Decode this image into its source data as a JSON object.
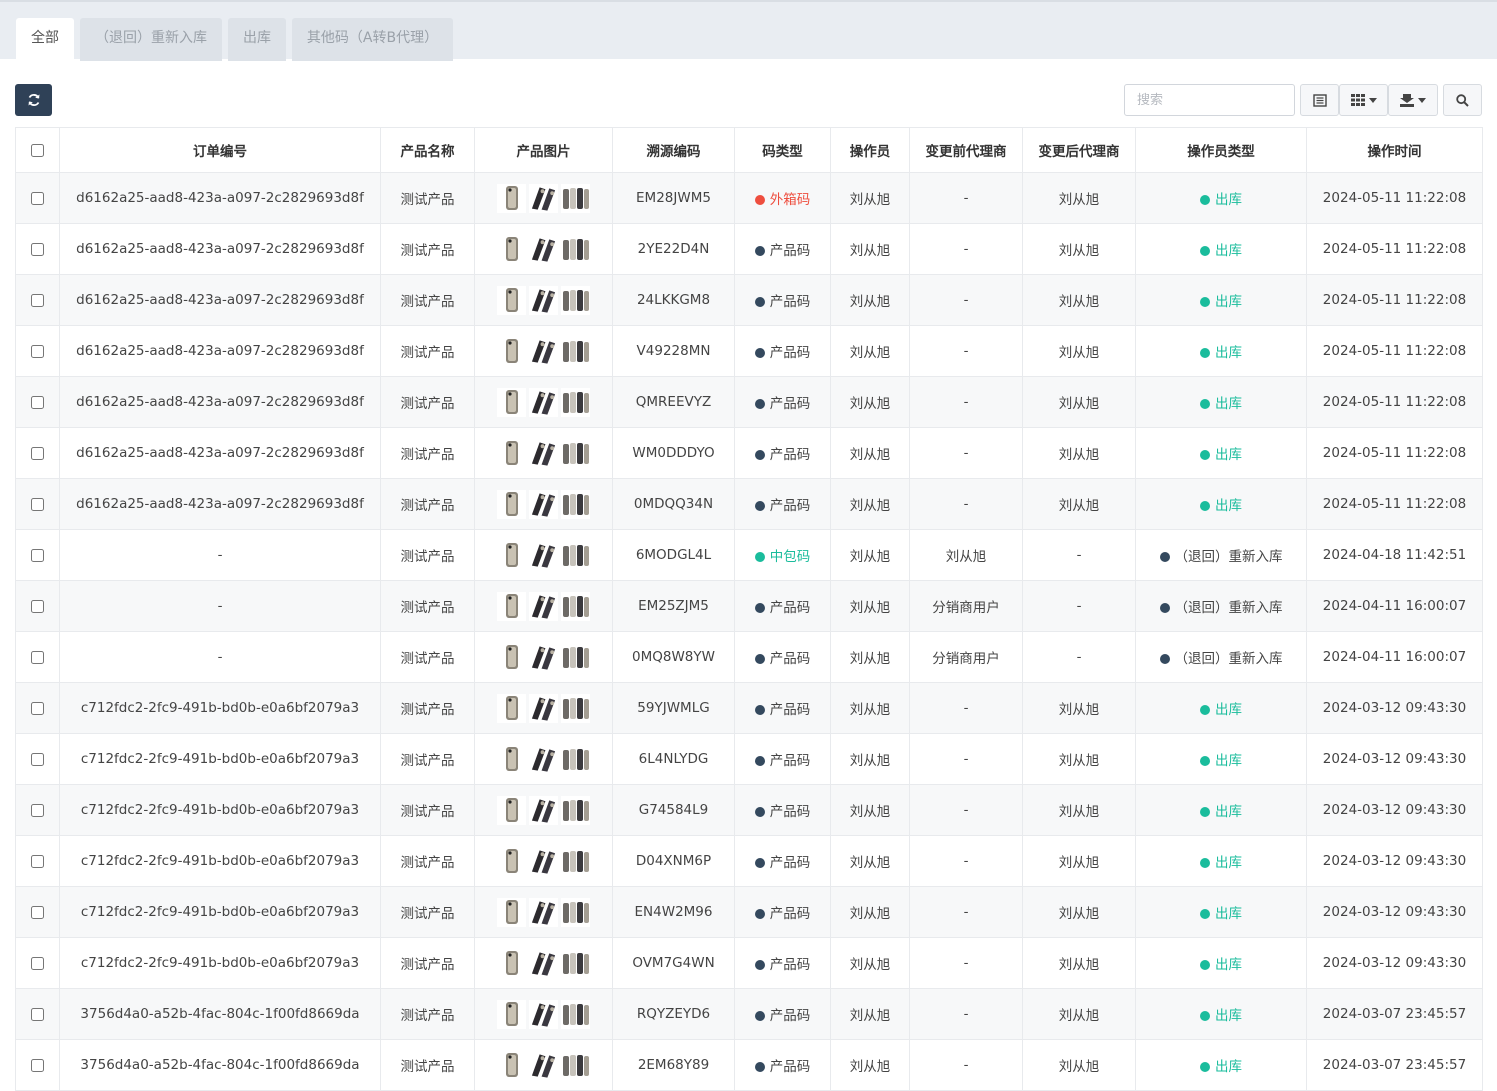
{
  "tabs": [
    {
      "label": "全部"
    },
    {
      "label": "（退回）重新入库"
    },
    {
      "label": "出库"
    },
    {
      "label": "其他码（A转B代理）"
    }
  ],
  "search": {
    "placeholder": "搜索"
  },
  "colors": {
    "red": "#ee4e3f",
    "green": "#1abc9c",
    "navy": "#34495e",
    "refresh": "#2f4157"
  },
  "table": {
    "headers": [
      "订单编号",
      "产品名称",
      "产品图片",
      "溯源编码",
      "码类型",
      "操作员",
      "变更前代理商",
      "变更后代理商",
      "操作员类型",
      "操作时间"
    ],
    "rows": [
      {
        "order": "d6162a25-aad8-423a-a097-2c2829693d8f",
        "product": "测试产品",
        "code": "EM28JWM5",
        "type": "外箱码",
        "type_color": "#ee4e3f",
        "operator": "刘从旭",
        "before": "-",
        "after": "刘从旭",
        "op_type": "出库",
        "op_color": "#1abc9c",
        "time": "2024-05-11 11:22:08"
      },
      {
        "order": "d6162a25-aad8-423a-a097-2c2829693d8f",
        "product": "测试产品",
        "code": "2YE22D4N",
        "type": "产品码",
        "type_color": "#34495e",
        "operator": "刘从旭",
        "before": "-",
        "after": "刘从旭",
        "op_type": "出库",
        "op_color": "#1abc9c",
        "time": "2024-05-11 11:22:08"
      },
      {
        "order": "d6162a25-aad8-423a-a097-2c2829693d8f",
        "product": "测试产品",
        "code": "24LKKGM8",
        "type": "产品码",
        "type_color": "#34495e",
        "operator": "刘从旭",
        "before": "-",
        "after": "刘从旭",
        "op_type": "出库",
        "op_color": "#1abc9c",
        "time": "2024-05-11 11:22:08"
      },
      {
        "order": "d6162a25-aad8-423a-a097-2c2829693d8f",
        "product": "测试产品",
        "code": "V49228MN",
        "type": "产品码",
        "type_color": "#34495e",
        "operator": "刘从旭",
        "before": "-",
        "after": "刘从旭",
        "op_type": "出库",
        "op_color": "#1abc9c",
        "time": "2024-05-11 11:22:08"
      },
      {
        "order": "d6162a25-aad8-423a-a097-2c2829693d8f",
        "product": "测试产品",
        "code": "QMREEVYZ",
        "type": "产品码",
        "type_color": "#34495e",
        "operator": "刘从旭",
        "before": "-",
        "after": "刘从旭",
        "op_type": "出库",
        "op_color": "#1abc9c",
        "time": "2024-05-11 11:22:08"
      },
      {
        "order": "d6162a25-aad8-423a-a097-2c2829693d8f",
        "product": "测试产品",
        "code": "WM0DDDYO",
        "type": "产品码",
        "type_color": "#34495e",
        "operator": "刘从旭",
        "before": "-",
        "after": "刘从旭",
        "op_type": "出库",
        "op_color": "#1abc9c",
        "time": "2024-05-11 11:22:08"
      },
      {
        "order": "d6162a25-aad8-423a-a097-2c2829693d8f",
        "product": "测试产品",
        "code": "0MDQQ34N",
        "type": "产品码",
        "type_color": "#34495e",
        "operator": "刘从旭",
        "before": "-",
        "after": "刘从旭",
        "op_type": "出库",
        "op_color": "#1abc9c",
        "time": "2024-05-11 11:22:08"
      },
      {
        "order": "-",
        "product": "测试产品",
        "code": "6MODGL4L",
        "type": "中包码",
        "type_color": "#1abc9c",
        "operator": "刘从旭",
        "before": "刘从旭",
        "after": "-",
        "op_type": "（退回）重新入库",
        "op_color": "#34495e",
        "time": "2024-04-18 11:42:51"
      },
      {
        "order": "-",
        "product": "测试产品",
        "code": "EM25ZJM5",
        "type": "产品码",
        "type_color": "#34495e",
        "operator": "刘从旭",
        "before": "分销商用户",
        "after": "-",
        "op_type": "（退回）重新入库",
        "op_color": "#34495e",
        "time": "2024-04-11 16:00:07"
      },
      {
        "order": "-",
        "product": "测试产品",
        "code": "0MQ8W8YW",
        "type": "产品码",
        "type_color": "#34495e",
        "operator": "刘从旭",
        "before": "分销商用户",
        "after": "-",
        "op_type": "（退回）重新入库",
        "op_color": "#34495e",
        "time": "2024-04-11 16:00:07"
      },
      {
        "order": "c712fdc2-2fc9-491b-bd0b-e0a6bf2079a3",
        "product": "测试产品",
        "code": "59YJWMLG",
        "type": "产品码",
        "type_color": "#34495e",
        "operator": "刘从旭",
        "before": "-",
        "after": "刘从旭",
        "op_type": "出库",
        "op_color": "#1abc9c",
        "time": "2024-03-12 09:43:30"
      },
      {
        "order": "c712fdc2-2fc9-491b-bd0b-e0a6bf2079a3",
        "product": "测试产品",
        "code": "6L4NLYDG",
        "type": "产品码",
        "type_color": "#34495e",
        "operator": "刘从旭",
        "before": "-",
        "after": "刘从旭",
        "op_type": "出库",
        "op_color": "#1abc9c",
        "time": "2024-03-12 09:43:30"
      },
      {
        "order": "c712fdc2-2fc9-491b-bd0b-e0a6bf2079a3",
        "product": "测试产品",
        "code": "G74584L9",
        "type": "产品码",
        "type_color": "#34495e",
        "operator": "刘从旭",
        "before": "-",
        "after": "刘从旭",
        "op_type": "出库",
        "op_color": "#1abc9c",
        "time": "2024-03-12 09:43:30"
      },
      {
        "order": "c712fdc2-2fc9-491b-bd0b-e0a6bf2079a3",
        "product": "测试产品",
        "code": "D04XNM6P",
        "type": "产品码",
        "type_color": "#34495e",
        "operator": "刘从旭",
        "before": "-",
        "after": "刘从旭",
        "op_type": "出库",
        "op_color": "#1abc9c",
        "time": "2024-03-12 09:43:30"
      },
      {
        "order": "c712fdc2-2fc9-491b-bd0b-e0a6bf2079a3",
        "product": "测试产品",
        "code": "EN4W2M96",
        "type": "产品码",
        "type_color": "#34495e",
        "operator": "刘从旭",
        "before": "-",
        "after": "刘从旭",
        "op_type": "出库",
        "op_color": "#1abc9c",
        "time": "2024-03-12 09:43:30"
      },
      {
        "order": "c712fdc2-2fc9-491b-bd0b-e0a6bf2079a3",
        "product": "测试产品",
        "code": "OVM7G4WN",
        "type": "产品码",
        "type_color": "#34495e",
        "operator": "刘从旭",
        "before": "-",
        "after": "刘从旭",
        "op_type": "出库",
        "op_color": "#1abc9c",
        "time": "2024-03-12 09:43:30"
      },
      {
        "order": "3756d4a0-a52b-4fac-804c-1f00fd8669da",
        "product": "测试产品",
        "code": "RQYZEYD6",
        "type": "产品码",
        "type_color": "#34495e",
        "operator": "刘从旭",
        "before": "-",
        "after": "刘从旭",
        "op_type": "出库",
        "op_color": "#1abc9c",
        "time": "2024-03-07 23:45:57"
      },
      {
        "order": "3756d4a0-a52b-4fac-804c-1f00fd8669da",
        "product": "测试产品",
        "code": "2EM68Y89",
        "type": "产品码",
        "type_color": "#34495e",
        "operator": "刘从旭",
        "before": "-",
        "after": "刘从旭",
        "op_type": "出库",
        "op_color": "#1abc9c",
        "time": "2024-03-07 23:45:57"
      }
    ]
  }
}
